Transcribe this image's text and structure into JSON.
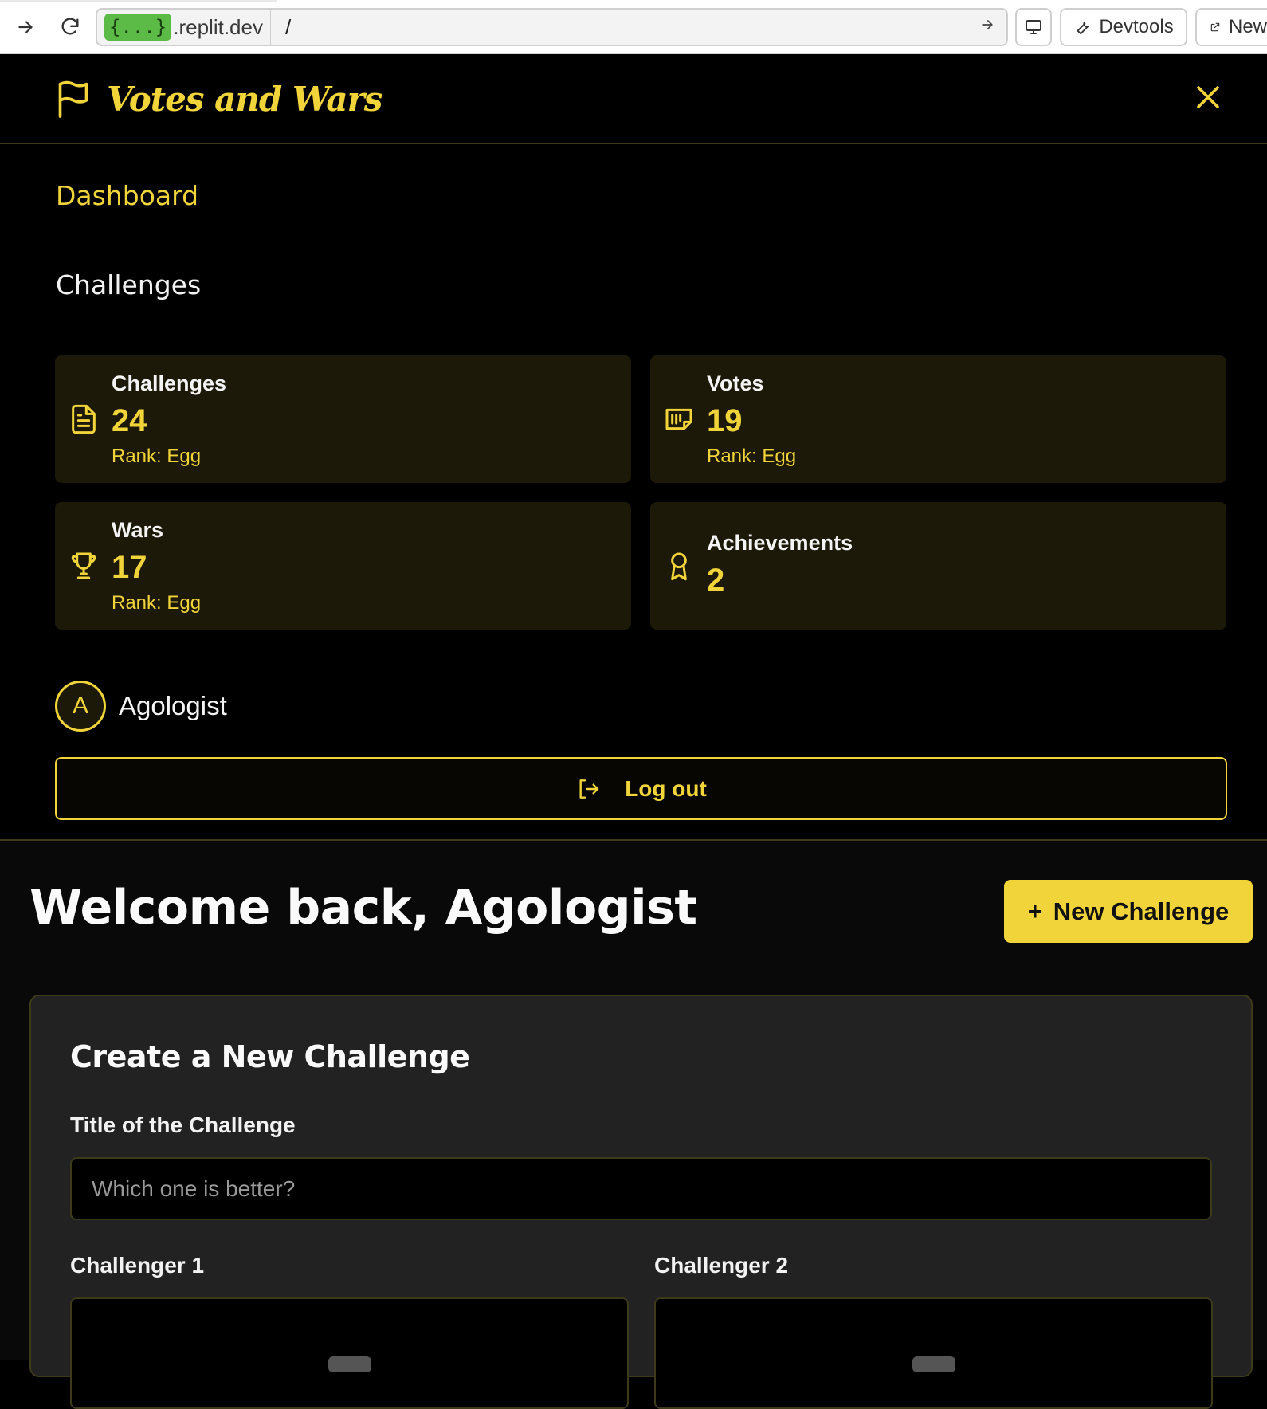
{
  "browser": {
    "url_badge": "{...}",
    "url_host": ".replit.dev",
    "url_path": "/",
    "devtools_label": "Devtools",
    "new_tab_label": "New"
  },
  "app": {
    "brand": "Votes and Wars",
    "accent_color": "#f0d43a"
  },
  "nav": {
    "dashboard": "Dashboard",
    "challenges": "Challenges"
  },
  "stats": [
    {
      "label": "Challenges",
      "value": "24",
      "rank": "Rank: Egg",
      "icon": "document-icon"
    },
    {
      "label": "Votes",
      "value": "19",
      "rank": "Rank: Egg",
      "icon": "ballot-icon"
    },
    {
      "label": "Wars",
      "value": "17",
      "rank": "Rank: Egg",
      "icon": "trophy-icon"
    },
    {
      "label": "Achievements",
      "value": "2",
      "icon": "award-icon"
    }
  ],
  "user": {
    "initial": "A",
    "name": "Agologist",
    "logout_label": "Log out"
  },
  "main": {
    "welcome": "Welcome back, Agologist",
    "new_challenge_label": "New Challenge",
    "new_challenge_plus": "+"
  },
  "form": {
    "title": "Create a New Challenge",
    "title_label": "Title of the Challenge",
    "title_placeholder": "Which one is better?",
    "challenger1_label": "Challenger 1",
    "challenger2_label": "Challenger 2"
  }
}
